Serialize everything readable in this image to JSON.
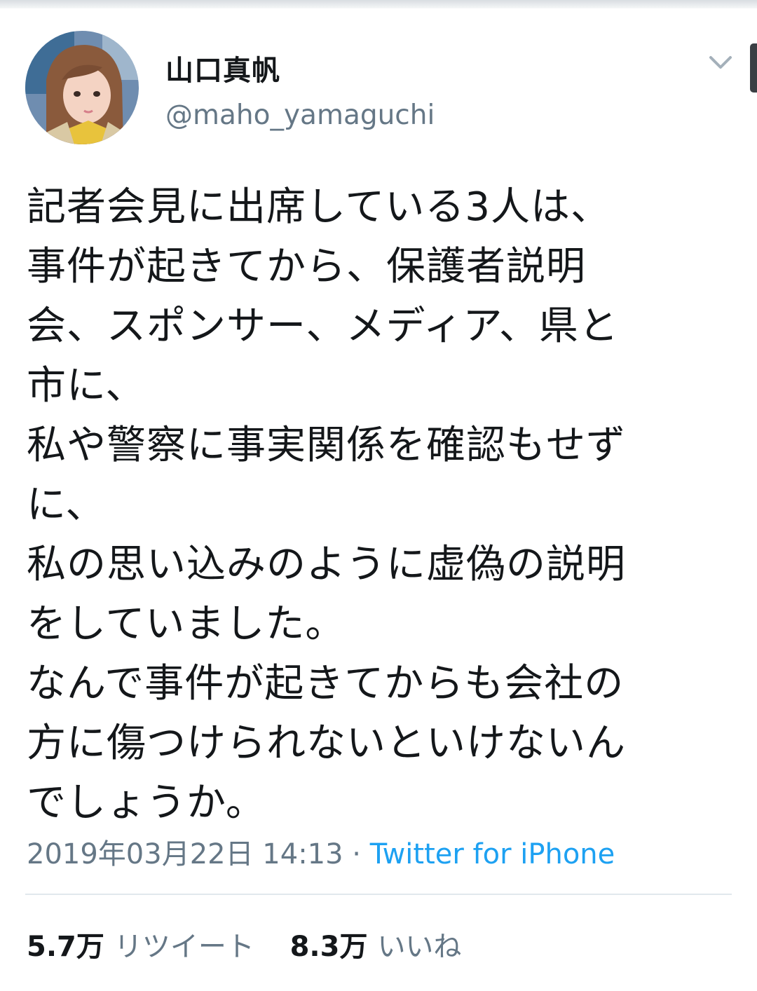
{
  "author": {
    "display_name": "山口真帆",
    "handle": "@maho_yamaguchi"
  },
  "tweet": {
    "lines": [
      "記者会見に出席している3人は、",
      "事件が起きてから、保護者説明",
      "会、スポンサー、メディア、県と",
      "市に、",
      "私や警察に事実関係を確認もせず",
      "に、",
      "私の思い込みのように虚偽の説明",
      "をしていました。",
      "なんで事件が起きてからも会社の",
      "方に傷つけられないといけないん",
      "でしょうか。"
    ],
    "timestamp": "2019年03月22日 14:13",
    "separator": " · ",
    "source": "Twitter for iPhone"
  },
  "stats": {
    "retweets_count": "5.7万",
    "retweets_label": "リツイート",
    "likes_count": "8.3万",
    "likes_label": "いいね"
  },
  "colors": {
    "text": "#14171a",
    "secondary": "#657786",
    "link": "#1da1f2",
    "divider": "#e1e8ed"
  },
  "icons": {
    "menu": "chevron-down-icon"
  }
}
